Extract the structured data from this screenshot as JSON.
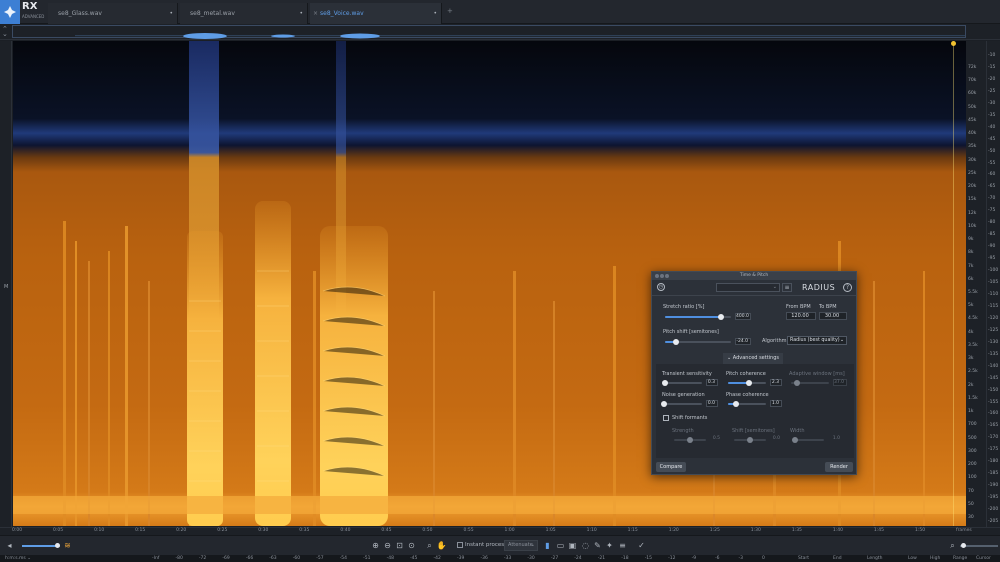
{
  "app": {
    "logo_text": "RX",
    "logo_sub": "ADVANCED"
  },
  "tabs": [
    {
      "label": "se8_Glass.wav",
      "close": "•"
    },
    {
      "label": "se8_metal.wav",
      "close": "•"
    },
    {
      "label": "se8_Voice.wav",
      "close": "•"
    }
  ],
  "tab_plus": "+",
  "colors": {
    "accent": "#5f9de6",
    "spectrum_mid": "#c46a12",
    "spectrum_hot": "#ffd25a",
    "playhead": "#f2c230"
  },
  "overview_icon": "overview-collapse-icon",
  "left_gutter": "M",
  "freq_ticks_mid": [
    "72k",
    "70k",
    "60k",
    "50k",
    "45k",
    "40k",
    "35k",
    "30k",
    "25k",
    "20k",
    "15k",
    "12k",
    "10k",
    "9k",
    "8k",
    "7k",
    "6k",
    "5.5k",
    "5k",
    "4.5k",
    "4k",
    "3.5k",
    "3k",
    "2.5k",
    "2k",
    "1.5k",
    "1k",
    "700",
    "500",
    "300",
    "200",
    "100",
    "70",
    "50",
    "30"
  ],
  "freq_ticks_right": [
    "-10",
    "-15",
    "-20",
    "-25",
    "-30",
    "-35",
    "-40",
    "-45",
    "-50",
    "-55",
    "-60",
    "-65",
    "-70",
    "-75",
    "-80",
    "-85",
    "-90",
    "-95",
    "-100",
    "-105",
    "-110",
    "-115",
    "-120",
    "-125",
    "-130",
    "-135",
    "-140",
    "-145",
    "-150",
    "-155",
    "-160",
    "-165",
    "-170",
    "-175",
    "-180",
    "-185",
    "-190",
    "-195",
    "-200",
    "-205"
  ],
  "time_ticks": [
    "0:00",
    "0:05",
    "0:10",
    "0:15",
    "0:20",
    "0:25",
    "0:30",
    "0:35",
    "0:40",
    "0:45",
    "0:50",
    "0:55",
    "1:00",
    "1:05",
    "1:10",
    "1:15",
    "1:20",
    "1:25",
    "1:30",
    "1:35",
    "1:40",
    "1:45",
    "1:50",
    "frames"
  ],
  "toolbar": {
    "instant_process_label": "Instant process",
    "attenuate_value": "Attenuate"
  },
  "status": {
    "format": "h:m:s.ms",
    "meter_ticks": [
      "-Inf",
      "-80",
      "-72",
      "-69",
      "-66",
      "-63",
      "-60",
      "-57",
      "-54",
      "-51",
      "-48",
      "-45",
      "-42",
      "-39",
      "-36",
      "-33",
      "-30",
      "-27",
      "-24",
      "-21",
      "-18",
      "-15",
      "-12",
      "-9",
      "-6",
      "-3",
      "0"
    ],
    "columns": [
      "Start",
      "End",
      "Length",
      "Low",
      "High",
      "Range",
      "Cursor"
    ]
  },
  "dialog": {
    "title": "Time & Pitch",
    "brand": "RADIUS",
    "preset_placeholder": "",
    "stretch_label": "Stretch ratio [%]",
    "stretch_value": "400.0",
    "stretch_fraction": 0.85,
    "from_bpm_label": "From BPM",
    "from_bpm": "120.00",
    "to_bpm_label": "To BPM",
    "to_bpm": "30.00",
    "pitch_label": "Pitch shift [semitones]",
    "pitch_value": "-24.0",
    "pitch_fraction": 0.17,
    "algorithm_label": "Algorithm",
    "algorithm_value": "Radius (best quality)",
    "advanced_label": "Advanced settings",
    "transient_label": "Transient sensitivity",
    "transient_value": "0.3",
    "transient_fraction": 0.02,
    "pitch_coherence_label": "Pitch coherence",
    "pitch_coherence_value": "2.3",
    "pitch_coherence_fraction": 0.55,
    "adaptive_label": "Adaptive window [ms]",
    "adaptive_value": "37.0",
    "adaptive_fraction": 0.15,
    "noise_label": "Noise generation",
    "noise_value": "0.0",
    "noise_fraction": 0.0,
    "phase_label": "Phase coherence",
    "phase_value": "1.0",
    "phase_fraction": 0.2,
    "shift_formants_label": "Shift formants",
    "strength_label": "Strength",
    "strength_value": "0.5",
    "strength_fraction": 0.5,
    "shift_label": "Shift [semitones]",
    "shift_value": "0.0",
    "shift_fraction": 0.5,
    "width_label": "Width",
    "width_value": "1.0",
    "width_fraction": 0.1,
    "compare_label": "Compare",
    "render_label": "Render"
  }
}
